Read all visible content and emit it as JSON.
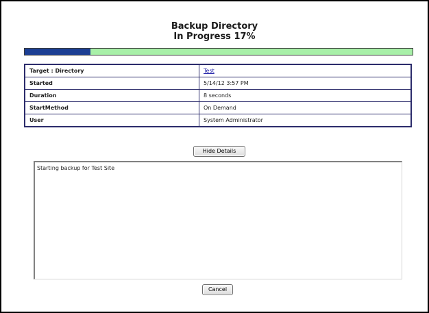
{
  "header": {
    "title_line1": "Backup Directory",
    "title_line2": "In Progress 17%"
  },
  "progress": {
    "percent": 17,
    "fill_color": "#1c3f94",
    "track_color": "#a8f0a8"
  },
  "details": [
    {
      "label": "Target : Directory",
      "value": "Test",
      "is_link": true
    },
    {
      "label": "Started",
      "value": "5/14/12 3:57 PM"
    },
    {
      "label": "Duration",
      "value": "8 seconds"
    },
    {
      "label": "StartMethod",
      "value": "On Demand"
    },
    {
      "label": "User",
      "value": "System Administrator"
    }
  ],
  "buttons": {
    "hide_details": "Hide Details",
    "cancel": "Cancel"
  },
  "log": {
    "text": "Starting backup for Test Site"
  }
}
